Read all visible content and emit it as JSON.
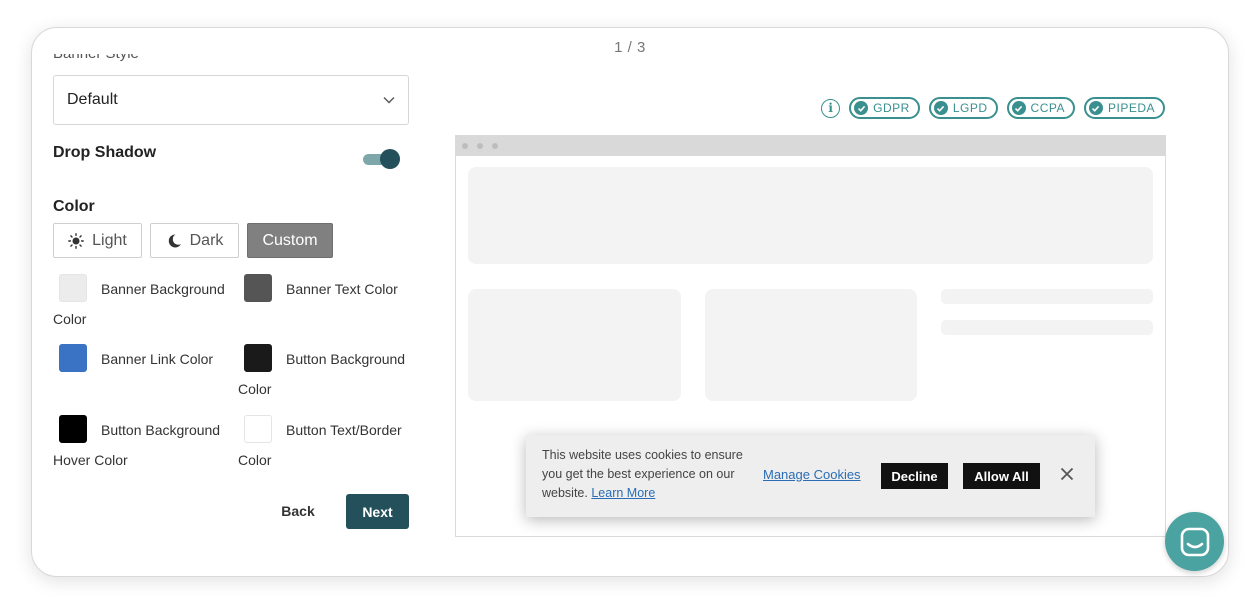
{
  "pager": "1 / 3",
  "section_label_clipped": "Banner Style",
  "style_select": {
    "value": "Default"
  },
  "drop_shadow": {
    "label": "Drop Shadow",
    "enabled": true
  },
  "color": {
    "label": "Color",
    "modes": [
      {
        "label": "Light",
        "icon": "sun-icon",
        "selected": false
      },
      {
        "label": "Dark",
        "icon": "moon-icon",
        "selected": false
      },
      {
        "label": "Custom",
        "selected": true
      }
    ],
    "swatches": [
      {
        "line1": "Banner Background",
        "line2": "Color",
        "hex": "#ececec"
      },
      {
        "line1": "Banner Text Color",
        "line2": "",
        "hex": "#555555"
      },
      {
        "line1": "Banner Link Color",
        "line2": "",
        "hex": "#3a72c4"
      },
      {
        "line1": "Button Background",
        "line2": "Color",
        "hex": "#1a1a1a"
      },
      {
        "line1": "Button Background",
        "line2": "Hover Color",
        "hex": "#000000"
      },
      {
        "line1": "Button Text/Border",
        "line2": "Color",
        "hex": "#ffffff"
      }
    ]
  },
  "nav": {
    "back": "Back",
    "next": "Next"
  },
  "compliance": [
    "GDPR",
    "LGPD",
    "CCPA",
    "PIPEDA"
  ],
  "cookie_banner": {
    "message": "This website uses cookies to ensure you get the best experience on our website.",
    "learn_more": "Learn More",
    "manage": "Manage Cookies",
    "decline": "Decline",
    "allow": "Allow All"
  },
  "colors": {
    "accent": "#23505b",
    "badge": "#3a8f8f",
    "chat": "#4aa3a0"
  }
}
